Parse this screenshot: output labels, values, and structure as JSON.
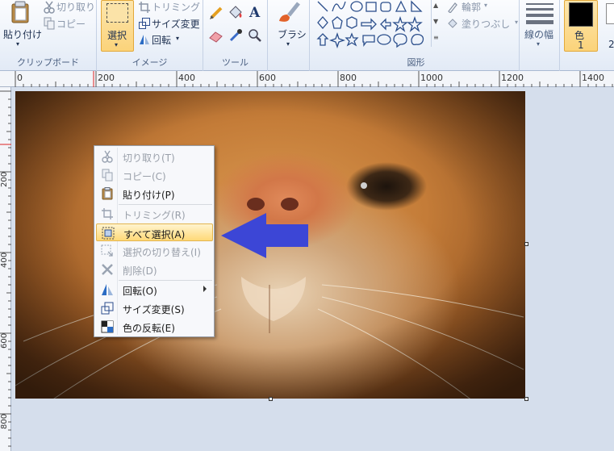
{
  "ribbon": {
    "clipboard": {
      "paste_label": "貼り付け",
      "cut_label": "切り取り",
      "copy_label": "コピー",
      "group_label": "クリップボード"
    },
    "image": {
      "select_label": "選択",
      "crop_label": "トリミング",
      "resize_label": "サイズ変更",
      "rotate_label": "回転",
      "group_label": "イメージ"
    },
    "tools": {
      "group_label": "ツール",
      "text_tool_glyph": "A"
    },
    "brushes": {
      "label": "ブラシ"
    },
    "shapes": {
      "outline_label": "輪郭",
      "fill_label": "塗りつぶし",
      "group_label": "図形"
    },
    "size": {
      "label": "線の幅"
    },
    "color1": {
      "label": "色",
      "number": "1"
    },
    "color2": {
      "number": "2"
    }
  },
  "ruler": {
    "h_ticks": [
      "0",
      "200",
      "400",
      "600",
      "800",
      "1000",
      "1200",
      "1400"
    ],
    "v_ticks": [
      "200",
      "400",
      "600",
      "800"
    ]
  },
  "context_menu": {
    "items": [
      {
        "label": "切り取り(T)",
        "enabled": false,
        "icon": "scissors-icon"
      },
      {
        "label": "コピー(C)",
        "enabled": false,
        "icon": "copy-icon"
      },
      {
        "label": "貼り付け(P)",
        "enabled": true,
        "icon": "paste-icon"
      },
      {
        "label": "トリミング(R)",
        "enabled": false,
        "icon": "crop-icon"
      },
      {
        "label": "すべて選択(A)",
        "enabled": true,
        "highlighted": true,
        "icon": "select-all-icon"
      },
      {
        "label": "選択の切り替え(I)",
        "enabled": false,
        "icon": "invert-selection-icon"
      },
      {
        "label": "削除(D)",
        "enabled": false,
        "icon": "delete-icon"
      },
      {
        "label": "回転(O)",
        "enabled": true,
        "submenu": true,
        "icon": "rotate-icon"
      },
      {
        "label": "サイズ変更(S)",
        "enabled": true,
        "icon": "resize-icon"
      },
      {
        "label": "色の反転(E)",
        "enabled": true,
        "icon": "invert-color-icon"
      }
    ]
  },
  "colors": {
    "annotation_arrow": "#3c46d6",
    "highlight": "#ffd978",
    "select_button": "#fbd37a"
  }
}
